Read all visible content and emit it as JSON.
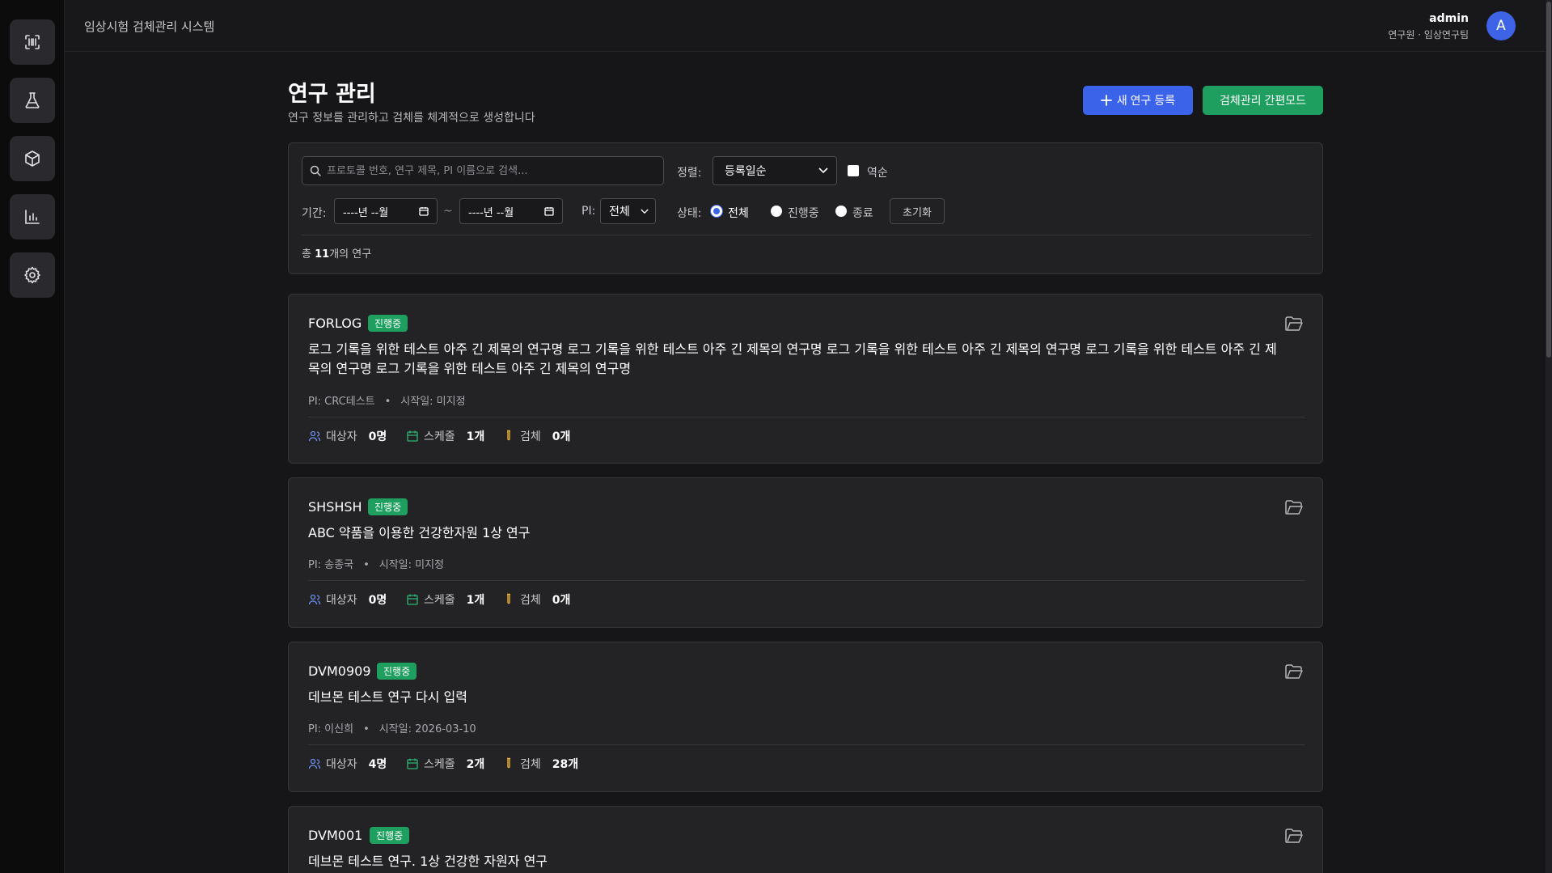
{
  "app": {
    "title": "임상시험 검체관리 시스템"
  },
  "sidebar": {
    "items": [
      {
        "icon": "scan-icon"
      },
      {
        "icon": "flask-icon"
      },
      {
        "icon": "box-icon"
      },
      {
        "icon": "bar-chart-icon"
      },
      {
        "icon": "gear-icon"
      }
    ]
  },
  "user": {
    "name": "admin",
    "role": "연구원 · 임상연구팀",
    "avatar": "A"
  },
  "page": {
    "title": "연구 관리",
    "subtitle": "연구 정보를 관리하고 검체를 체계적으로 생성합니다",
    "new_button": "새 연구 등록",
    "quick_button": "검체관리 간편모드"
  },
  "filters": {
    "search_placeholder": "프로토콜 번호, 연구 제목, PI 이름으로 검색...",
    "sort_label": "정렬:",
    "sort_value": "등록일순",
    "reverse_label": "역순",
    "period_label": "기간:",
    "date_from": "----년 --월",
    "date_to": "----년 --월",
    "date_sep": "~",
    "pi_label": "PI:",
    "pi_value": "전체",
    "status_label": "상태:",
    "status_all": "전체",
    "status_ongoing": "진행중",
    "status_done": "종료",
    "reset": "초기화",
    "total_prefix": "총 ",
    "total_count": "11",
    "total_suffix": "개의 연구"
  },
  "studies": [
    {
      "code": "FORLOG",
      "status": "진행중",
      "title": "로그 기록을 위한 테스트 아주 긴 제목의 연구명 로그 기록을 위한 테스트 아주 긴 제목의 연구명 로그 기록을 위한 테스트 아주 긴 제목의 연구명 로그 기록을 위한 테스트 아주 긴 제목의 연구명 로그 기록을 위한 테스트 아주 긴 제목의 연구명",
      "pi": "PI: CRC테스트",
      "start": "시작일: 미지정",
      "subjects_label": "대상자",
      "subjects": "0명",
      "schedule_label": "스케줄",
      "schedule": "1개",
      "samples_label": "검체",
      "samples": "0개"
    },
    {
      "code": "SHSHSH",
      "status": "진행중",
      "title": "ABC 약품을 이용한 건강한자원 1상 연구",
      "pi": "PI: 송종국",
      "start": "시작일: 미지정",
      "subjects_label": "대상자",
      "subjects": "0명",
      "schedule_label": "스케줄",
      "schedule": "1개",
      "samples_label": "검체",
      "samples": "0개"
    },
    {
      "code": "DVM0909",
      "status": "진행중",
      "title": "데브몬 테스트 연구 다시 입력",
      "pi": "PI: 이신희",
      "start": "시작일: 2026-03-10",
      "subjects_label": "대상자",
      "subjects": "4명",
      "schedule_label": "스케줄",
      "schedule": "2개",
      "samples_label": "검체",
      "samples": "28개"
    },
    {
      "code": "DVM001",
      "status": "진행중",
      "title": "데브몬 테스트 연구. 1상 건강한 자원자 연구"
    }
  ],
  "colors": {
    "accent": "#3b63e9",
    "success": "#1f9f5f",
    "background": "#161618",
    "card": "#232326"
  }
}
